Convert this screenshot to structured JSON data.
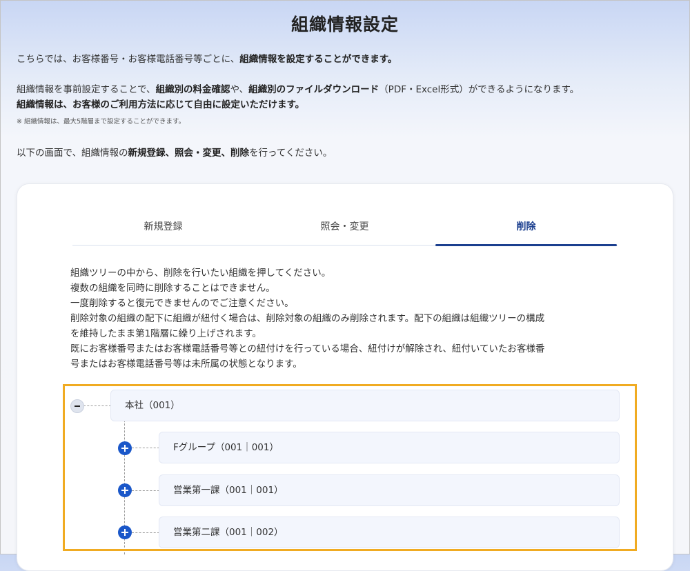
{
  "page": {
    "title": "組織情報設定"
  },
  "intro": {
    "line1_a": "こちらでは、お客様番号・お客様電話番号等ごとに、",
    "line1_b": "組織情報を設定することができます。",
    "line2_a": "組織情報を事前設定することで、",
    "line2_b": "組織別の料金確認",
    "line2_c": "や、",
    "line2_d": "組織別のファイルダウンロード",
    "line2_e": "（PDF・Excel形式）ができるようになります。",
    "line3": "組織情報は、お客様のご利用方法に応じて自由に設定いただけます。",
    "note": "※ 組織情報は、最大5階層まで設定することができます。",
    "line4_a": "以下の画面で、組織情報の",
    "line4_b": "新規登録、照会・変更、削除",
    "line4_c": "を行ってください。"
  },
  "tabs": [
    {
      "label": "新規登録",
      "active": false
    },
    {
      "label": "照会・変更",
      "active": false
    },
    {
      "label": "削除",
      "active": true
    }
  ],
  "instructions": [
    "組織ツリーの中から、削除を行いたい組織を押してください。",
    "複数の組織を同時に削除することはできません。",
    "一度削除すると復元できませんのでご注意ください。",
    "削除対象の組織の配下に組織が紐付く場合は、削除対象の組織のみ削除されます。配下の組織は組織ツリーの構成",
    "を維持したまま第1階層に繰り上げされます。",
    "既にお客様番号またはお客様電話番号等との紐付けを行っている場合、紐付けが解除され、紐付いていたお客様番",
    "号またはお客様電話番号等は未所属の状態となります。"
  ],
  "tree": {
    "root": {
      "label": "本社（001）",
      "expanded": true,
      "toggle_icon": "minus-icon"
    },
    "children": [
      {
        "label": "Fグループ（001｜001）",
        "toggle_icon": "plus-icon"
      },
      {
        "label": "営業第一課（001｜001）",
        "toggle_icon": "plus-icon"
      },
      {
        "label": "営業第二課（001｜002）",
        "toggle_icon": "plus-icon"
      }
    ]
  },
  "colors": {
    "accent": "#1b3f8f",
    "plus_button": "#1a57c9",
    "highlight_border": "#f0ab22",
    "node_background": "#f3f6fd"
  }
}
